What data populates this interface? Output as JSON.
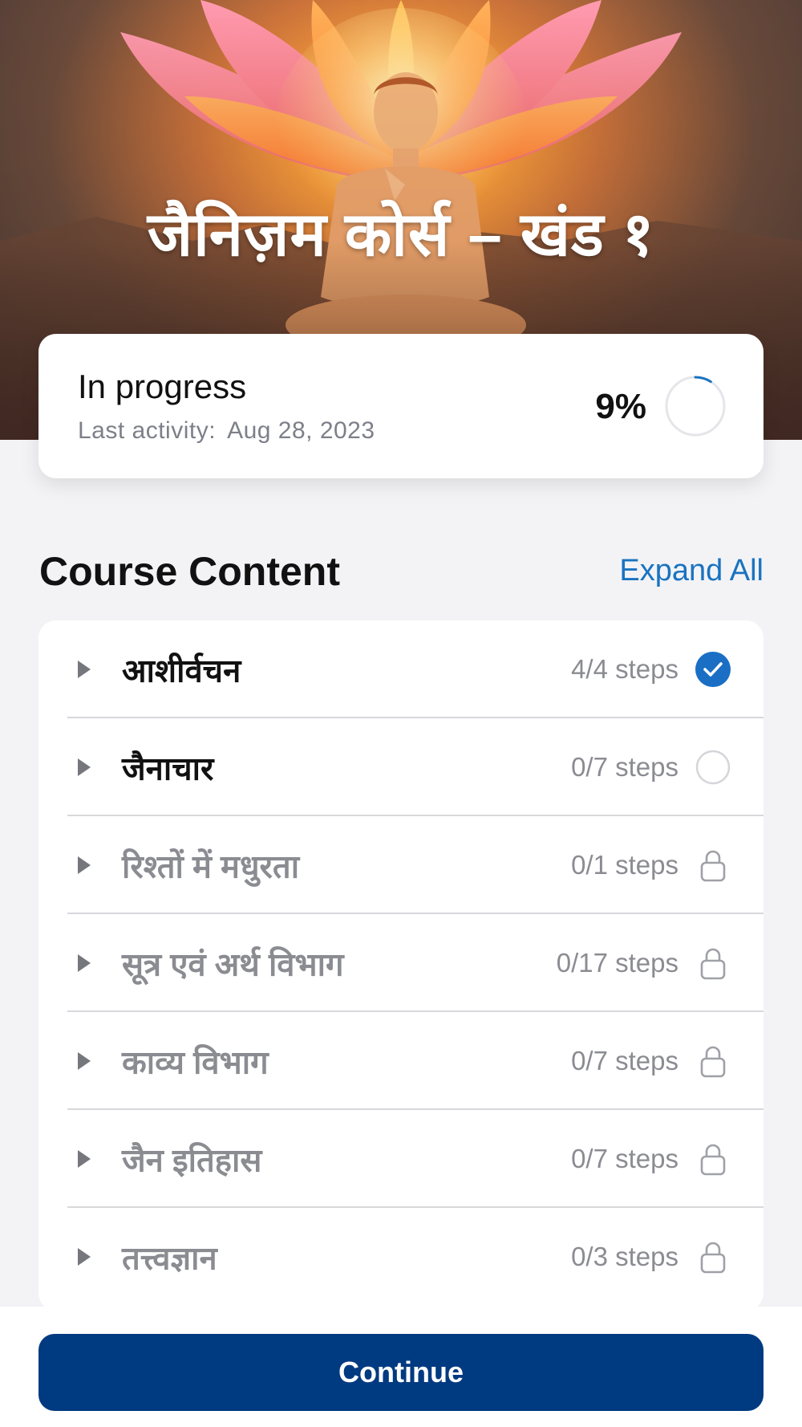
{
  "hero": {
    "title": "जैनिज़म कोर्स – खंड १"
  },
  "progress": {
    "status": "In progress",
    "last_activity_label": "Last activity:",
    "last_activity_date": "Aug 28, 2023",
    "percent_label": "9%",
    "percent_value": 9
  },
  "course_content": {
    "title": "Course Content",
    "expand_all_label": "Expand All",
    "sections": [
      {
        "title": "आशीर्वचन",
        "steps": "4/4 steps",
        "state": "completed",
        "active": true
      },
      {
        "title": "जैनाचार",
        "steps": "0/7 steps",
        "state": "not-started",
        "active": true
      },
      {
        "title": "रिश्तों में मधुरता",
        "steps": "0/1 steps",
        "state": "locked",
        "active": false
      },
      {
        "title": "सूत्र एवं अर्थ विभाग",
        "steps": "0/17 steps",
        "state": "locked",
        "active": false
      },
      {
        "title": "काव्य विभाग",
        "steps": "0/7 steps",
        "state": "locked",
        "active": false
      },
      {
        "title": "जैन इतिहास",
        "steps": "0/7 steps",
        "state": "locked",
        "active": false
      },
      {
        "title": "तत्त्वज्ञान",
        "steps": "0/3 steps",
        "state": "locked",
        "active": false
      }
    ]
  },
  "footer": {
    "continue_label": "Continue"
  },
  "colors": {
    "accent": "#1a73c0",
    "primary_button": "#003a80",
    "check_fill": "#1a6fc4"
  }
}
